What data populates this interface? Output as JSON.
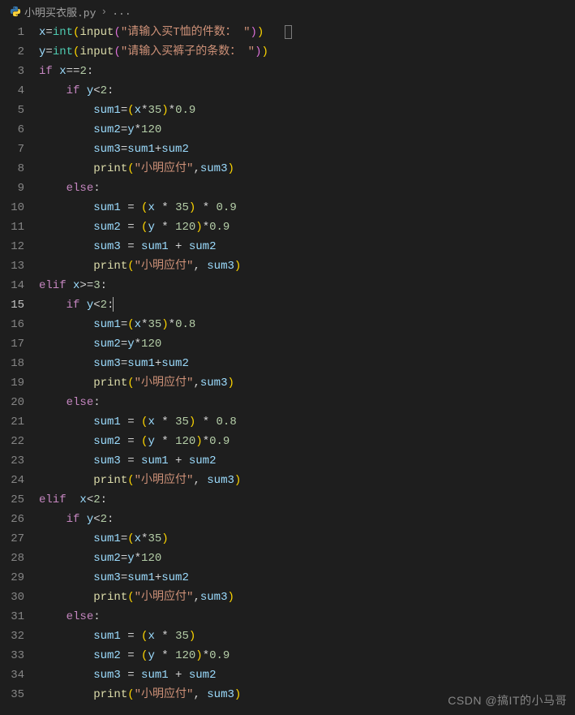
{
  "breadcrumb": {
    "file": "小明买衣服.py",
    "rest": "..."
  },
  "activeLine": 15,
  "lines": [
    {
      "n": 1,
      "i": 0,
      "t": "assign-int-input",
      "lhs": "x",
      "prompt": "请输入买T恤的件数：",
      "findbox": true
    },
    {
      "n": 2,
      "i": 0,
      "t": "assign-int-input",
      "lhs": "y",
      "prompt": "请输入买裤子的条数："
    },
    {
      "n": 3,
      "i": 0,
      "t": "if",
      "kw": "if",
      "cond": [
        [
          "var",
          "x"
        ],
        [
          "op",
          "=="
        ],
        [
          "num",
          "2"
        ]
      ]
    },
    {
      "n": 4,
      "i": 1,
      "t": "if",
      "kw": "if",
      "cond": [
        [
          "var",
          "y"
        ],
        [
          "op",
          "<"
        ],
        [
          "num",
          "2"
        ]
      ]
    },
    {
      "n": 5,
      "i": 2,
      "t": "assignexpr",
      "lhs": "sum1",
      "tight": true,
      "rhs": [
        [
          "p",
          "("
        ],
        [
          "var",
          "x"
        ],
        [
          "op",
          "*"
        ],
        [
          "num",
          "35"
        ],
        [
          "p",
          ")"
        ],
        [
          "op",
          "*"
        ],
        [
          "num",
          "0.9"
        ]
      ]
    },
    {
      "n": 6,
      "i": 2,
      "t": "assignexpr",
      "lhs": "sum2",
      "tight": true,
      "rhs": [
        [
          "var",
          "y"
        ],
        [
          "op",
          "*"
        ],
        [
          "num",
          "120"
        ]
      ]
    },
    {
      "n": 7,
      "i": 2,
      "t": "assignexpr",
      "lhs": "sum3",
      "tight": true,
      "rhs": [
        [
          "var",
          "sum1"
        ],
        [
          "op",
          "+"
        ],
        [
          "var",
          "sum2"
        ]
      ]
    },
    {
      "n": 8,
      "i": 2,
      "t": "print",
      "tight": true,
      "msg": "小明应付",
      "arg": "sum3"
    },
    {
      "n": 9,
      "i": 1,
      "t": "else"
    },
    {
      "n": 10,
      "i": 2,
      "t": "assignexpr",
      "lhs": "sum1",
      "rhs": [
        [
          "p",
          "("
        ],
        [
          "var",
          "x"
        ],
        [
          "op",
          " * "
        ],
        [
          "num",
          "35"
        ],
        [
          "p",
          ")"
        ],
        [
          "op",
          " * "
        ],
        [
          "num",
          "0.9"
        ]
      ]
    },
    {
      "n": 11,
      "i": 2,
      "t": "assignexpr",
      "lhs": "sum2",
      "rhs": [
        [
          "p",
          "("
        ],
        [
          "var",
          "y"
        ],
        [
          "op",
          " * "
        ],
        [
          "num",
          "120"
        ],
        [
          "p",
          ")"
        ],
        [
          "op",
          "*"
        ],
        [
          "num",
          "0.9"
        ]
      ]
    },
    {
      "n": 12,
      "i": 2,
      "t": "assignexpr",
      "lhs": "sum3",
      "rhs": [
        [
          "var",
          "sum1"
        ],
        [
          "op",
          " + "
        ],
        [
          "var",
          "sum2"
        ]
      ]
    },
    {
      "n": 13,
      "i": 2,
      "t": "print",
      "msg": "小明应付",
      "arg": "sum3"
    },
    {
      "n": 14,
      "i": 0,
      "t": "if",
      "kw": "elif",
      "cond": [
        [
          "var",
          "x"
        ],
        [
          "op",
          ">="
        ],
        [
          "num",
          "3"
        ]
      ]
    },
    {
      "n": 15,
      "i": 1,
      "t": "if",
      "kw": "if",
      "cond": [
        [
          "var",
          "y"
        ],
        [
          "op",
          "<"
        ],
        [
          "num",
          "2"
        ]
      ],
      "cursor": true
    },
    {
      "n": 16,
      "i": 2,
      "t": "assignexpr",
      "lhs": "sum1",
      "tight": true,
      "rhs": [
        [
          "p",
          "("
        ],
        [
          "var",
          "x"
        ],
        [
          "op",
          "*"
        ],
        [
          "num",
          "35"
        ],
        [
          "p",
          ")"
        ],
        [
          "op",
          "*"
        ],
        [
          "num",
          "0.8"
        ]
      ]
    },
    {
      "n": 17,
      "i": 2,
      "t": "assignexpr",
      "lhs": "sum2",
      "tight": true,
      "rhs": [
        [
          "var",
          "y"
        ],
        [
          "op",
          "*"
        ],
        [
          "num",
          "120"
        ]
      ]
    },
    {
      "n": 18,
      "i": 2,
      "t": "assignexpr",
      "lhs": "sum3",
      "tight": true,
      "rhs": [
        [
          "var",
          "sum1"
        ],
        [
          "op",
          "+"
        ],
        [
          "var",
          "sum2"
        ]
      ]
    },
    {
      "n": 19,
      "i": 2,
      "t": "print",
      "tight": true,
      "msg": "小明应付",
      "arg": "sum3"
    },
    {
      "n": 20,
      "i": 1,
      "t": "else"
    },
    {
      "n": 21,
      "i": 2,
      "t": "assignexpr",
      "lhs": "sum1",
      "rhs": [
        [
          "p",
          "("
        ],
        [
          "var",
          "x"
        ],
        [
          "op",
          " * "
        ],
        [
          "num",
          "35"
        ],
        [
          "p",
          ")"
        ],
        [
          "op",
          " * "
        ],
        [
          "num",
          "0.8"
        ]
      ]
    },
    {
      "n": 22,
      "i": 2,
      "t": "assignexpr",
      "lhs": "sum2",
      "rhs": [
        [
          "p",
          "("
        ],
        [
          "var",
          "y"
        ],
        [
          "op",
          " * "
        ],
        [
          "num",
          "120"
        ],
        [
          "p",
          ")"
        ],
        [
          "op",
          "*"
        ],
        [
          "num",
          "0.9"
        ]
      ]
    },
    {
      "n": 23,
      "i": 2,
      "t": "assignexpr",
      "lhs": "sum3",
      "rhs": [
        [
          "var",
          "sum1"
        ],
        [
          "op",
          " + "
        ],
        [
          "var",
          "sum2"
        ]
      ]
    },
    {
      "n": 24,
      "i": 2,
      "t": "print",
      "msg": "小明应付",
      "arg": "sum3"
    },
    {
      "n": 25,
      "i": 0,
      "t": "if",
      "kw": "elif",
      "space2": true,
      "cond": [
        [
          "var",
          "x"
        ],
        [
          "op",
          "<"
        ],
        [
          "num",
          "2"
        ]
      ]
    },
    {
      "n": 26,
      "i": 1,
      "t": "if",
      "kw": "if",
      "cond": [
        [
          "var",
          "y"
        ],
        [
          "op",
          "<"
        ],
        [
          "num",
          "2"
        ]
      ]
    },
    {
      "n": 27,
      "i": 2,
      "t": "assignexpr",
      "lhs": "sum1",
      "tight": true,
      "rhs": [
        [
          "p",
          "("
        ],
        [
          "var",
          "x"
        ],
        [
          "op",
          "*"
        ],
        [
          "num",
          "35"
        ],
        [
          "p",
          ")"
        ]
      ]
    },
    {
      "n": 28,
      "i": 2,
      "t": "assignexpr",
      "lhs": "sum2",
      "tight": true,
      "rhs": [
        [
          "var",
          "y"
        ],
        [
          "op",
          "*"
        ],
        [
          "num",
          "120"
        ]
      ]
    },
    {
      "n": 29,
      "i": 2,
      "t": "assignexpr",
      "lhs": "sum3",
      "tight": true,
      "rhs": [
        [
          "var",
          "sum1"
        ],
        [
          "op",
          "+"
        ],
        [
          "var",
          "sum2"
        ]
      ]
    },
    {
      "n": 30,
      "i": 2,
      "t": "print",
      "tight": true,
      "msg": "小明应付",
      "arg": "sum3"
    },
    {
      "n": 31,
      "i": 1,
      "t": "else"
    },
    {
      "n": 32,
      "i": 2,
      "t": "assignexpr",
      "lhs": "sum1",
      "rhs": [
        [
          "p",
          "("
        ],
        [
          "var",
          "x"
        ],
        [
          "op",
          " * "
        ],
        [
          "num",
          "35"
        ],
        [
          "p",
          ")"
        ]
      ]
    },
    {
      "n": 33,
      "i": 2,
      "t": "assignexpr",
      "lhs": "sum2",
      "rhs": [
        [
          "p",
          "("
        ],
        [
          "var",
          "y"
        ],
        [
          "op",
          " * "
        ],
        [
          "num",
          "120"
        ],
        [
          "p",
          ")"
        ],
        [
          "op",
          "*"
        ],
        [
          "num",
          "0.9"
        ]
      ]
    },
    {
      "n": 34,
      "i": 2,
      "t": "assignexpr",
      "lhs": "sum3",
      "rhs": [
        [
          "var",
          "sum1"
        ],
        [
          "op",
          " + "
        ],
        [
          "var",
          "sum2"
        ]
      ]
    },
    {
      "n": 35,
      "i": 2,
      "t": "print",
      "msg": "小明应付",
      "arg": "sum3"
    }
  ],
  "watermark": "CSDN @搞IT的小马哥"
}
